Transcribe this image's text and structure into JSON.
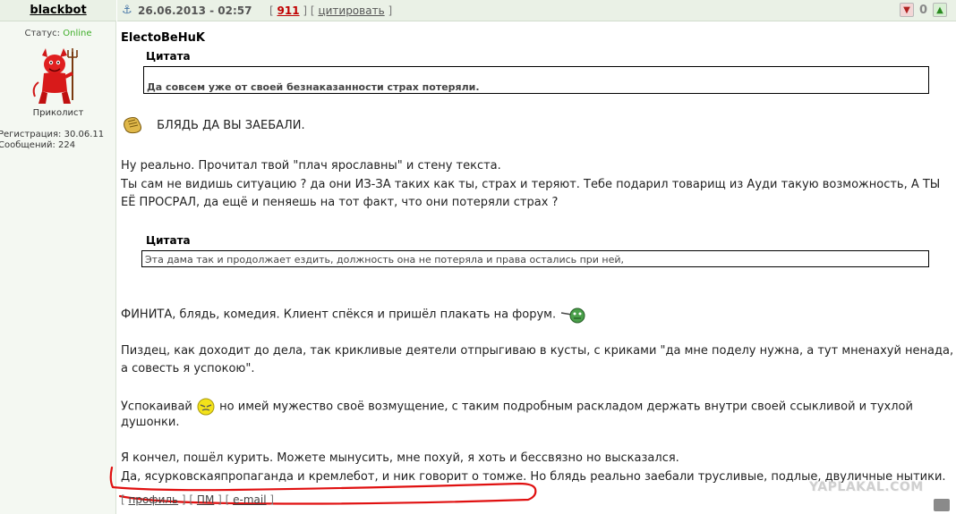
{
  "user": {
    "name": "blackbot",
    "status_label": "Статус:",
    "status_value": "Online",
    "rank": "Приколист",
    "registered": "Регистрация: 30.06.11",
    "messages": "Сообщений: 224"
  },
  "header": {
    "anchor_icon": "anchor-icon",
    "date": "26.06.2013 - 02:57",
    "bracket_open": "[",
    "bracket_close": "]",
    "post_number": "911",
    "quote_label": "цитировать",
    "vote_count": "0"
  },
  "post": {
    "author": "ElectoBeHuK",
    "quote1_title": "Цитата",
    "quote1_text": "Да совсем уже от своей безнаказанности страх потеряли.",
    "line1": "БЛЯДЬ ДА ВЫ ЗАЕБАЛИ.",
    "line2": "Ну реально. Прочитал твой \"плач ярославны\" и стену текста.",
    "line3": "Ты сам не видишь ситуацию ? да они ИЗ-ЗА таких как ты, страх и теряют. Тебе подарил товарищ из Ауди такую возможность, А ТЫ",
    "line4": "ЕЁ ПРОСРАЛ, да ещё и пеняешь на тот факт, что они потеряли страх ?",
    "quote2_title": "Цитата",
    "quote2_text": "Эта дама так и продолжает ездить, должность она не потеряла и права остались при ней,",
    "line5": "ФИНИТА, блядь, комедия. Клиент спёкся и пришёл плакать на форум.",
    "line6": "Пиздец, как доходит до дела, так крикливые деятели отпрыгиваю в кусты, с криками \"да мне поделу нужна, а тут мненахуй ненада,",
    "line7": "а совесть я успокою\".",
    "line8a": "Успокаивай",
    "line8b": "но имей мужество своё возмущение, с таким подробным раскладом держать внутри своей ссыкливой и тухлой",
    "line9": "душонки.",
    "line10": "Я кончел, пошёл курить. Можете мынусить, мне похуй, я хоть и бессвязно но высказался.",
    "line11": "Да, ясурковскаяпропаганда и кремлебот, и ник говорит о томже. Но блядь реально заебали трусливые, подлые, двуличные нытики."
  },
  "footer": {
    "profile_label": "профиль",
    "pm_label": "ПМ",
    "email_label": "e-mail"
  },
  "watermark": "YAPLAKAL.COM",
  "colors": {
    "online": "#3fae2a",
    "post_number": "#c00000",
    "header_bg": "#eaf1e6",
    "annotation": "#e01010"
  }
}
